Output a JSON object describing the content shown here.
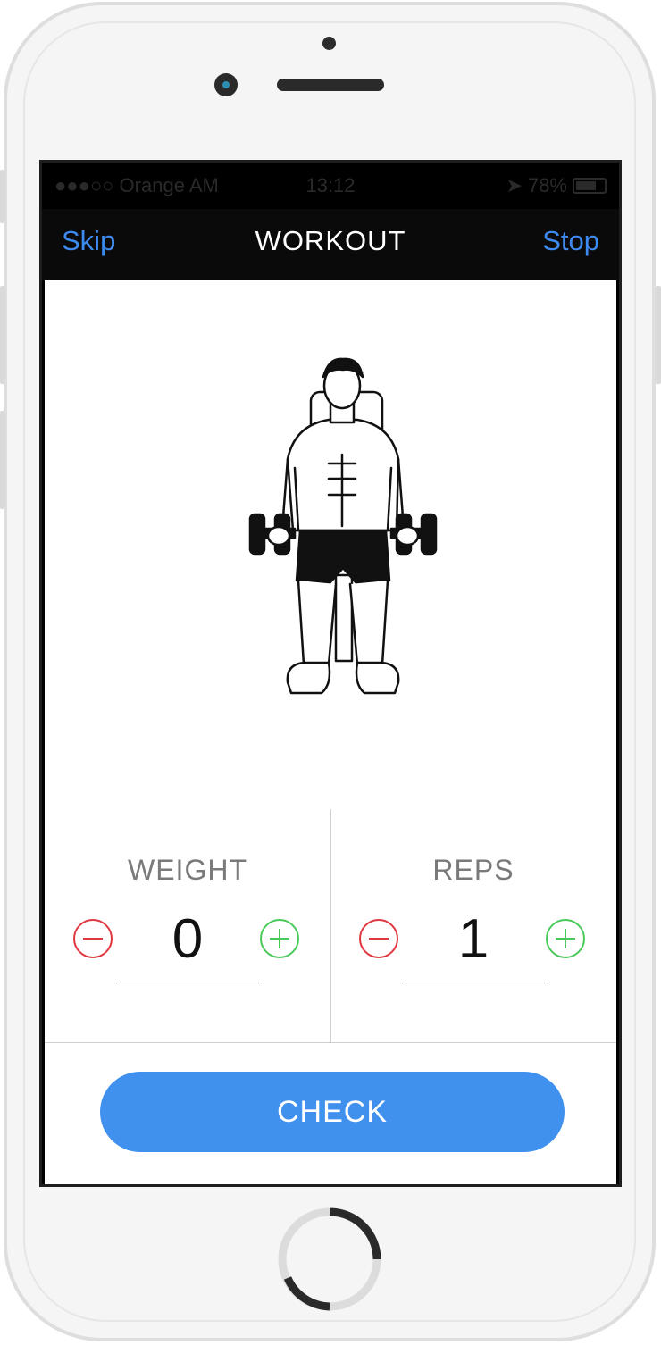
{
  "status_bar": {
    "carrier": "●●●○○ Orange AM",
    "time": "13:12",
    "battery": "78%"
  },
  "nav": {
    "left_label": "Skip",
    "title": "WORKOUT",
    "right_label": "Stop"
  },
  "exercise": {
    "image": "seated-dumbbell-curl-illustration"
  },
  "weight": {
    "label": "WEIGHT",
    "value": "0"
  },
  "reps": {
    "label": "REPS",
    "value": "1"
  },
  "check_button": {
    "label": "CHECK"
  },
  "colors": {
    "accent": "#4090EE",
    "nav_link": "#3D8BF0",
    "minus": "#E0373F",
    "plus": "#49C95A"
  }
}
